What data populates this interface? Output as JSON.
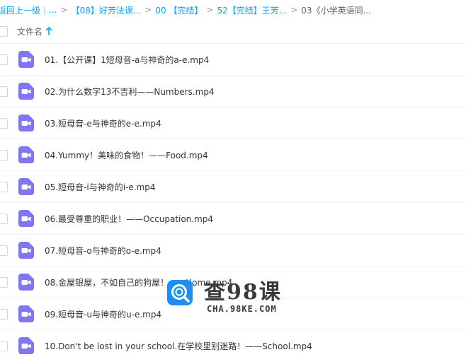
{
  "breadcrumb": {
    "back": "返回上一级",
    "ellipsis": "...",
    "crumbs": [
      "【08】好芳法课...",
      "00 【完结】",
      "52【完结】王芳..."
    ],
    "current": "03《小学英语同..."
  },
  "header": {
    "column_label": "文件名"
  },
  "files": [
    "01.【公开课】1短母音-a与神奇的a-e.mp4",
    "02.为什么数字13不吉利——Numbers.mp4",
    "03.短母音-e与神奇的e-e.mp4",
    "04.Yummy！美味的食物！——Food.mp4",
    "05.短母音-i与神奇的i-e.mp4",
    "06.最受尊重的职业！——Occupation.mp4",
    "07.短母音-o与神奇的o-e.mp4",
    "08.金屋银屋，不如自己的狗屋！——Home.mp4",
    "09.短母音-u与神奇的u-e.mp4",
    "10.Don't be lost in your school.在学校里别迷路！——School.mp4"
  ],
  "watermark": {
    "title": "查98课",
    "url": "CHA.98KE.COM"
  },
  "colors": {
    "link": "#06a7ff",
    "video_icon": "#8076f5",
    "watermark_blue": "#1e8ff0"
  },
  "icons": {
    "file": "video-file-icon",
    "sort": "arrow-up-icon",
    "watermark": "search-logo-icon"
  }
}
